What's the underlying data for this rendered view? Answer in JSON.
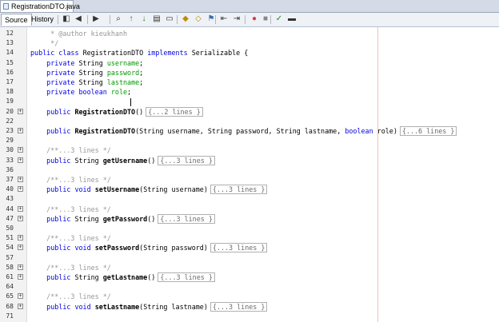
{
  "file_tab": {
    "label": "RegistrationDTO.java",
    "close": "×"
  },
  "view_tabs": {
    "source": "Source",
    "history": "History"
  },
  "colors": {
    "keyword": "#0000e6",
    "comment": "#969696",
    "field": "#009900"
  },
  "toolbar_icons": [
    "last-edit-icon",
    "back-icon",
    "forward-icon",
    "find-selection-icon",
    "find-previous-icon",
    "find-next-icon",
    "toggle-highlight-icon",
    "toggle-rect-select-icon",
    "prev-bookmark-icon",
    "next-bookmark-icon",
    "toggle-bookmark-icon",
    "shift-left-icon",
    "shift-right-icon",
    "start-macro-icon",
    "stop-macro-icon",
    "comment-icon",
    "uncomment-icon"
  ],
  "lines": [
    {
      "n": "12",
      "p": [
        {
          "t": "     * @author kieukhanh",
          "c": "cm"
        }
      ]
    },
    {
      "n": "13",
      "p": [
        {
          "t": "     */",
          "c": "cm"
        }
      ]
    },
    {
      "n": "14",
      "p": [
        {
          "t": "public class ",
          "c": "kw"
        },
        {
          "t": "RegistrationDTO ",
          "c": ""
        },
        {
          "t": "implements ",
          "c": "kw"
        },
        {
          "t": "Serializable {",
          "c": ""
        }
      ]
    },
    {
      "n": "15",
      "p": [
        {
          "t": "    private ",
          "c": "kw"
        },
        {
          "t": "String ",
          "c": ""
        },
        {
          "t": "username",
          "c": "fld"
        },
        {
          "t": ";",
          "c": ""
        }
      ]
    },
    {
      "n": "16",
      "p": [
        {
          "t": "    private ",
          "c": "kw"
        },
        {
          "t": "String ",
          "c": ""
        },
        {
          "t": "password",
          "c": "fld"
        },
        {
          "t": ";",
          "c": ""
        }
      ]
    },
    {
      "n": "17",
      "p": [
        {
          "t": "    private ",
          "c": "kw"
        },
        {
          "t": "String ",
          "c": ""
        },
        {
          "t": "lastname",
          "c": "fld"
        },
        {
          "t": ";",
          "c": ""
        }
      ]
    },
    {
      "n": "18",
      "p": [
        {
          "t": "    private ",
          "c": "kw"
        },
        {
          "t": "boolean ",
          "c": "kw"
        },
        {
          "t": "role",
          "c": "fld"
        },
        {
          "t": ";",
          "c": ""
        }
      ]
    },
    {
      "n": "19",
      "p": []
    },
    {
      "n": "20",
      "fold": true,
      "p": [
        {
          "t": "    public ",
          "c": "kw"
        },
        {
          "t": "RegistrationDTO",
          "c": "meth"
        },
        {
          "t": "()",
          "c": ""
        }
      ],
      "box": "{...2 lines }"
    },
    {
      "n": "22",
      "p": []
    },
    {
      "n": "23",
      "fold": true,
      "p": [
        {
          "t": "    public ",
          "c": "kw"
        },
        {
          "t": "RegistrationDTO",
          "c": "meth"
        },
        {
          "t": "(String username, String password, String lastname, ",
          "c": ""
        },
        {
          "t": "boolean ",
          "c": "kw"
        },
        {
          "t": "role)",
          "c": ""
        }
      ],
      "box": "{...6 lines }"
    },
    {
      "n": "29",
      "p": []
    },
    {
      "n": "30",
      "fold": true,
      "p": [
        {
          "t": "    /**...3 lines */",
          "c": "cm"
        }
      ]
    },
    {
      "n": "33",
      "fold": true,
      "p": [
        {
          "t": "    public ",
          "c": "kw"
        },
        {
          "t": "String ",
          "c": ""
        },
        {
          "t": "getUsername",
          "c": "meth"
        },
        {
          "t": "()",
          "c": ""
        }
      ],
      "box": "{...3 lines }"
    },
    {
      "n": "36",
      "p": []
    },
    {
      "n": "37",
      "fold": true,
      "p": [
        {
          "t": "    /**...3 lines */",
          "c": "cm"
        }
      ]
    },
    {
      "n": "40",
      "fold": true,
      "p": [
        {
          "t": "    public ",
          "c": "kw"
        },
        {
          "t": "void ",
          "c": "kw"
        },
        {
          "t": "setUsername",
          "c": "meth"
        },
        {
          "t": "(String username)",
          "c": ""
        }
      ],
      "box": "{...3 lines }"
    },
    {
      "n": "43",
      "p": []
    },
    {
      "n": "44",
      "fold": true,
      "p": [
        {
          "t": "    /**...3 lines */",
          "c": "cm"
        }
      ]
    },
    {
      "n": "47",
      "fold": true,
      "p": [
        {
          "t": "    public ",
          "c": "kw"
        },
        {
          "t": "String ",
          "c": ""
        },
        {
          "t": "getPassword",
          "c": "meth"
        },
        {
          "t": "()",
          "c": ""
        }
      ],
      "box": "{...3 lines }"
    },
    {
      "n": "50",
      "p": []
    },
    {
      "n": "51",
      "fold": true,
      "p": [
        {
          "t": "    /**...3 lines */",
          "c": "cm"
        }
      ]
    },
    {
      "n": "54",
      "fold": true,
      "p": [
        {
          "t": "    public ",
          "c": "kw"
        },
        {
          "t": "void ",
          "c": "kw"
        },
        {
          "t": "setPassword",
          "c": "meth"
        },
        {
          "t": "(String password)",
          "c": ""
        }
      ],
      "box": "{...3 lines }"
    },
    {
      "n": "57",
      "p": []
    },
    {
      "n": "58",
      "fold": true,
      "p": [
        {
          "t": "    /**...3 lines */",
          "c": "cm"
        }
      ]
    },
    {
      "n": "61",
      "fold": true,
      "p": [
        {
          "t": "    public ",
          "c": "kw"
        },
        {
          "t": "String ",
          "c": ""
        },
        {
          "t": "getLastname",
          "c": "meth"
        },
        {
          "t": "()",
          "c": ""
        }
      ],
      "box": "{...3 lines }"
    },
    {
      "n": "64",
      "p": []
    },
    {
      "n": "65",
      "fold": true,
      "p": [
        {
          "t": "    /**...3 lines */",
          "c": "cm"
        }
      ]
    },
    {
      "n": "68",
      "fold": true,
      "p": [
        {
          "t": "    public ",
          "c": "kw"
        },
        {
          "t": "void ",
          "c": "kw"
        },
        {
          "t": "setLastname",
          "c": "meth"
        },
        {
          "t": "(String lastname)",
          "c": ""
        }
      ],
      "box": "{...3 lines }"
    },
    {
      "n": "71",
      "p": []
    }
  ]
}
